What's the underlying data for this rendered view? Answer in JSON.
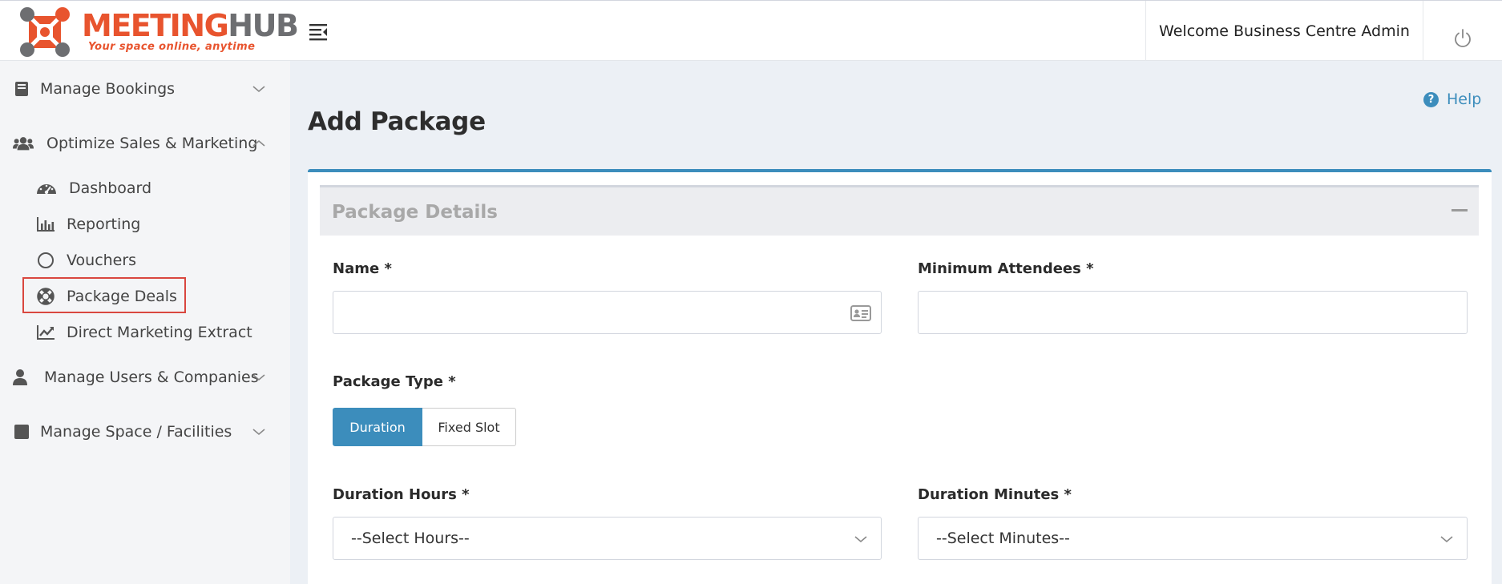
{
  "header": {
    "logo": {
      "brand_part1": "MEETING",
      "brand_part2": "HUB",
      "tagline": "Your space online, anytime"
    },
    "welcome_text": "Welcome Business Centre Admin"
  },
  "sidebar": {
    "items": [
      {
        "label": "Manage Bookings",
        "icon": "book-icon",
        "expanded": false
      },
      {
        "label": "Optimize Sales & Marketing",
        "icon": "users-icon",
        "expanded": true,
        "children": [
          {
            "label": "Dashboard",
            "icon": "tachometer-icon"
          },
          {
            "label": "Reporting",
            "icon": "bar-chart-icon"
          },
          {
            "label": "Vouchers",
            "icon": "circle-icon"
          },
          {
            "label": "Package Deals",
            "icon": "life-ring-icon",
            "active": true
          },
          {
            "label": "Direct Marketing Extract",
            "icon": "line-chart-icon"
          }
        ]
      },
      {
        "label": "Manage Users & Companies",
        "icon": "user-icon",
        "expanded": false
      },
      {
        "label": "Manage Space / Facilities",
        "icon": "square-icon",
        "expanded": false
      }
    ]
  },
  "page": {
    "title": "Add Package",
    "help_label": "Help",
    "help_icon": "?"
  },
  "form": {
    "section_title": "Package Details",
    "name": {
      "label": "Name *",
      "value": "",
      "icon": "id-card-icon"
    },
    "min_attendees": {
      "label": "Minimum Attendees *",
      "value": ""
    },
    "package_type": {
      "label": "Package Type *",
      "options": [
        "Duration",
        "Fixed Slot"
      ],
      "selected": "Duration"
    },
    "duration_hours": {
      "label": "Duration Hours *",
      "selected": "--Select Hours--"
    },
    "duration_minutes": {
      "label": "Duration Minutes *",
      "selected": "--Select Minutes--"
    }
  },
  "colors": {
    "accent": "#3c8dbc",
    "brand_orange": "#e8542e",
    "brand_gray": "#6d6e71",
    "highlight_border": "#d9473f",
    "sidebar_bg": "#f4f5f7",
    "content_bg": "#ecf0f5"
  }
}
